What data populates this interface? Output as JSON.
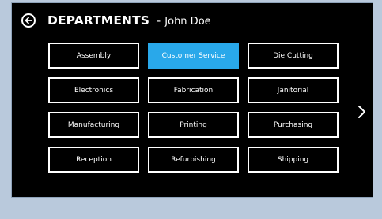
{
  "header": {
    "title": "DEPARTMENTS",
    "separator": "-",
    "user_name": "John Doe"
  },
  "departments": [
    {
      "label": "Assembly",
      "selected": false
    },
    {
      "label": "Customer Service",
      "selected": true
    },
    {
      "label": "Die Cutting",
      "selected": false
    },
    {
      "label": "Electronics",
      "selected": false
    },
    {
      "label": "Fabrication",
      "selected": false
    },
    {
      "label": "Janitorial",
      "selected": false
    },
    {
      "label": "Manufacturing",
      "selected": false
    },
    {
      "label": "Printing",
      "selected": false
    },
    {
      "label": "Purchasing",
      "selected": false
    },
    {
      "label": "Reception",
      "selected": false
    },
    {
      "label": "Refurbishing",
      "selected": false
    },
    {
      "label": "Shipping",
      "selected": false
    }
  ],
  "icons": {
    "back": "back-arrow-circle-icon",
    "next": "chevron-right-icon"
  },
  "colors": {
    "background": "#000000",
    "text": "#ffffff",
    "selected": "#29a8ea",
    "frame": "#b9c9dc"
  }
}
